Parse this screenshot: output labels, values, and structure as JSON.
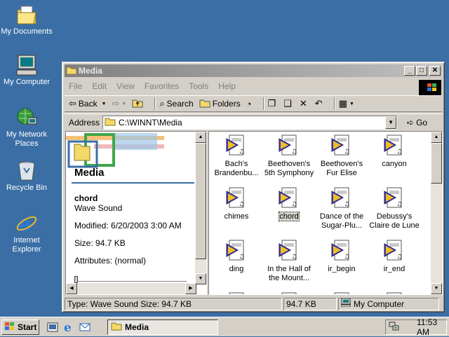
{
  "desktop": {
    "icons": [
      {
        "label": "My Documents"
      },
      {
        "label": "My Computer"
      },
      {
        "label": "My Network Places"
      },
      {
        "label": "Recycle Bin"
      },
      {
        "label": "Internet Explorer"
      }
    ]
  },
  "window": {
    "title": "Media",
    "menu": [
      "File",
      "Edit",
      "View",
      "Favorites",
      "Tools",
      "Help"
    ],
    "toolbar": {
      "back": "Back",
      "search": "Search",
      "folders": "Folders"
    },
    "address": {
      "label": "Address",
      "value": "C:\\WINNT\\Media",
      "go": "Go"
    }
  },
  "pane": {
    "title": "Media",
    "name": "chord",
    "type": "Wave Sound",
    "modified": "Modified: 6/20/2003 3:00 AM",
    "size": "Size: 94.7 KB",
    "attributes": "Attributes: (normal)"
  },
  "files": [
    {
      "label": "Bach's Brandenbu..."
    },
    {
      "label": "Beethoven's 5th Symphony"
    },
    {
      "label": "Beethoven's Fur Elise"
    },
    {
      "label": "canyon"
    },
    {
      "label": "chimes"
    },
    {
      "label": "chord",
      "selected": true
    },
    {
      "label": "Dance of the Sugar-Plu..."
    },
    {
      "label": "Debussy's Claire de Lune"
    },
    {
      "label": "ding"
    },
    {
      "label": "In the Hall of the Mount..."
    },
    {
      "label": "ir_begin"
    },
    {
      "label": "ir_end"
    },
    {
      "label": ""
    },
    {
      "label": ""
    },
    {
      "label": ""
    },
    {
      "label": ""
    }
  ],
  "status": {
    "info": "Type: Wave Sound Size: 94.7 KB",
    "size": "94.7 KB",
    "zone": "My Computer"
  },
  "taskbar": {
    "start": "Start",
    "task": "Media",
    "clock": "11:53 AM"
  },
  "colors": {
    "desktop": "#3a6ea5",
    "face": "#d4d0c8",
    "title_inactive": "#808080"
  }
}
